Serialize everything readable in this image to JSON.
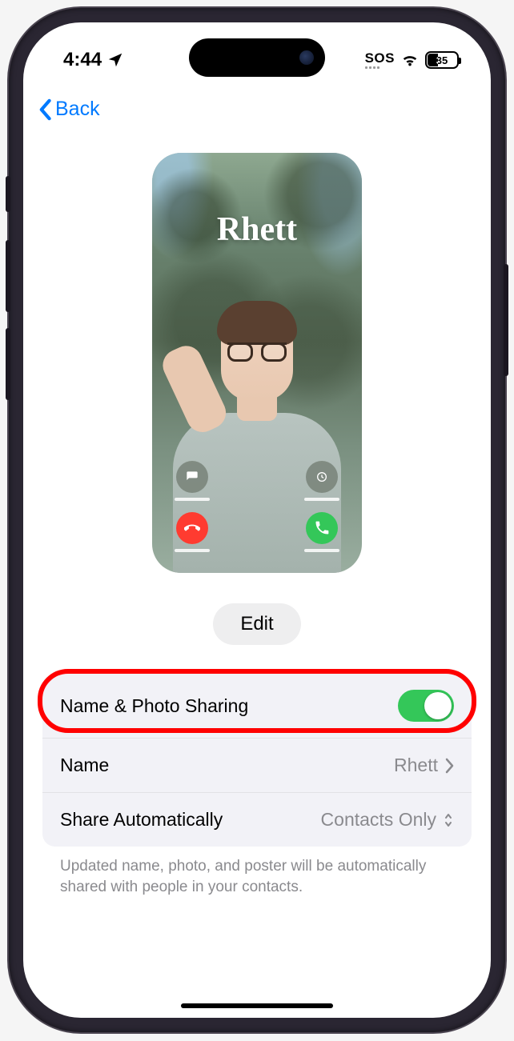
{
  "status": {
    "time": "4:44",
    "location_icon": "location-arrow",
    "sos": "SOS",
    "wifi_icon": "wifi",
    "battery_pct": "35"
  },
  "nav": {
    "back_label": "Back"
  },
  "poster": {
    "name": "Rhett"
  },
  "actions": {
    "edit_label": "Edit"
  },
  "settings": {
    "sharing": {
      "label": "Name & Photo Sharing",
      "enabled": true
    },
    "name": {
      "label": "Name",
      "value": "Rhett"
    },
    "share_auto": {
      "label": "Share Automatically",
      "value": "Contacts Only"
    },
    "footer": "Updated name, photo, and poster will be automatically shared with people in your contacts."
  },
  "annotation": {
    "highlight": "name-photo-sharing-row"
  }
}
